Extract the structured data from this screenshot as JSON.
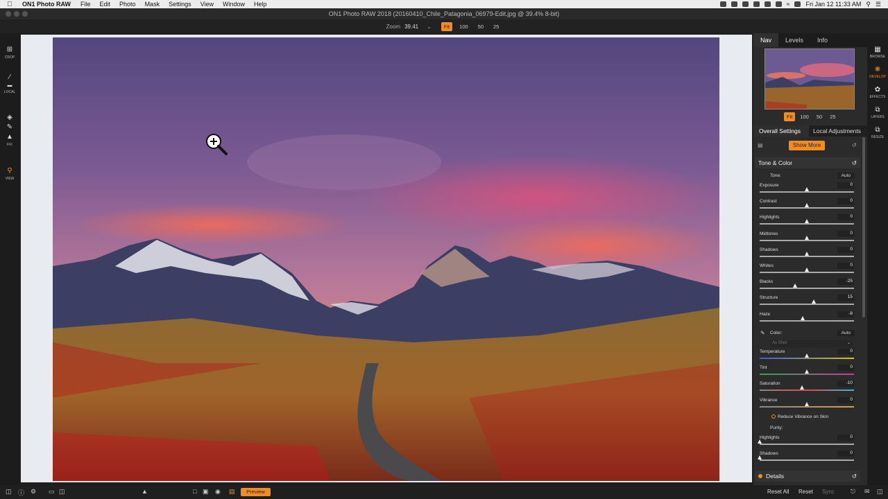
{
  "menubar": {
    "app_name": "ON1 Photo RAW",
    "items": [
      "File",
      "Edit",
      "Photo",
      "Mask",
      "Settings",
      "View",
      "Window",
      "Help"
    ],
    "clock": "Fri Jan 12  11:33 AM"
  },
  "window": {
    "title": "ON1 Photo RAW 2018 (20160410_Chile_Patagonia_06979-Edit.jpg @ 39.4% 8-bit)"
  },
  "zoom": {
    "label": "Zoom",
    "value": "39.41",
    "buttons": [
      "Fit",
      "100",
      "50",
      "25"
    ],
    "active": "Fit"
  },
  "left_tools": [
    {
      "name": "crop",
      "label": "CROP"
    },
    {
      "name": "local",
      "label": "LOCAL"
    },
    {
      "name": "fix",
      "label": "FIX"
    },
    {
      "name": "view",
      "label": "VIEW"
    }
  ],
  "right_panel": {
    "tabs": [
      "Nav",
      "Levels",
      "Info"
    ],
    "active_tab": "Nav",
    "nav_zoom": [
      "Fit",
      "100",
      "50",
      "25"
    ],
    "settings_tabs": [
      "Overall Settings",
      "Local Adjustments"
    ],
    "show_more": "Show More",
    "tone_color": {
      "title": "Tone & Color",
      "tone_label": "Tone:",
      "auto": "Auto",
      "sliders": [
        {
          "label": "Exposure",
          "value": "0",
          "pos": 0.5
        },
        {
          "label": "Contrast",
          "value": "0",
          "pos": 0.5
        },
        {
          "label": "Highlights",
          "value": "0",
          "pos": 0.5
        },
        {
          "label": "Midtones",
          "value": "0",
          "pos": 0.5
        },
        {
          "label": "Shadows",
          "value": "0",
          "pos": 0.5
        },
        {
          "label": "Whites",
          "value": "0",
          "pos": 0.5
        },
        {
          "label": "Blacks",
          "value": "-25",
          "pos": 0.375
        },
        {
          "label": "Structure",
          "value": "15",
          "pos": 0.575
        },
        {
          "label": "Haze",
          "value": "-8",
          "pos": 0.46
        }
      ],
      "color_label": "Color:",
      "color_auto": "Auto",
      "white_balance": "As Shot",
      "color_sliders": [
        {
          "label": "Temperature",
          "value": "0",
          "pos": 0.5
        },
        {
          "label": "Tint",
          "value": "0",
          "pos": 0.5
        },
        {
          "label": "Saturation",
          "value": "-10",
          "pos": 0.45
        },
        {
          "label": "Vibrance",
          "value": "0",
          "pos": 0.5
        }
      ],
      "reduce_vibrance": "Reduce Vibrance on Skin",
      "purity_label": "Purity:",
      "purity_sliders": [
        {
          "label": "Highlights",
          "value": "0",
          "pos": 0.0
        },
        {
          "label": "Shadows",
          "value": "0",
          "pos": 0.0
        }
      ]
    },
    "details_title": "Details"
  },
  "modules": [
    {
      "name": "browse",
      "label": "BROWSE"
    },
    {
      "name": "develop",
      "label": "DEVELOP"
    },
    {
      "name": "effects",
      "label": "EFFECTS"
    },
    {
      "name": "layers",
      "label": "LAYERS"
    },
    {
      "name": "resize",
      "label": "RESIZE"
    }
  ],
  "bottom": {
    "preview": "Preview",
    "reset_all": "Reset All",
    "reset": "Reset",
    "sync": "Sync"
  },
  "colors": {
    "accent": "#f28c28"
  }
}
